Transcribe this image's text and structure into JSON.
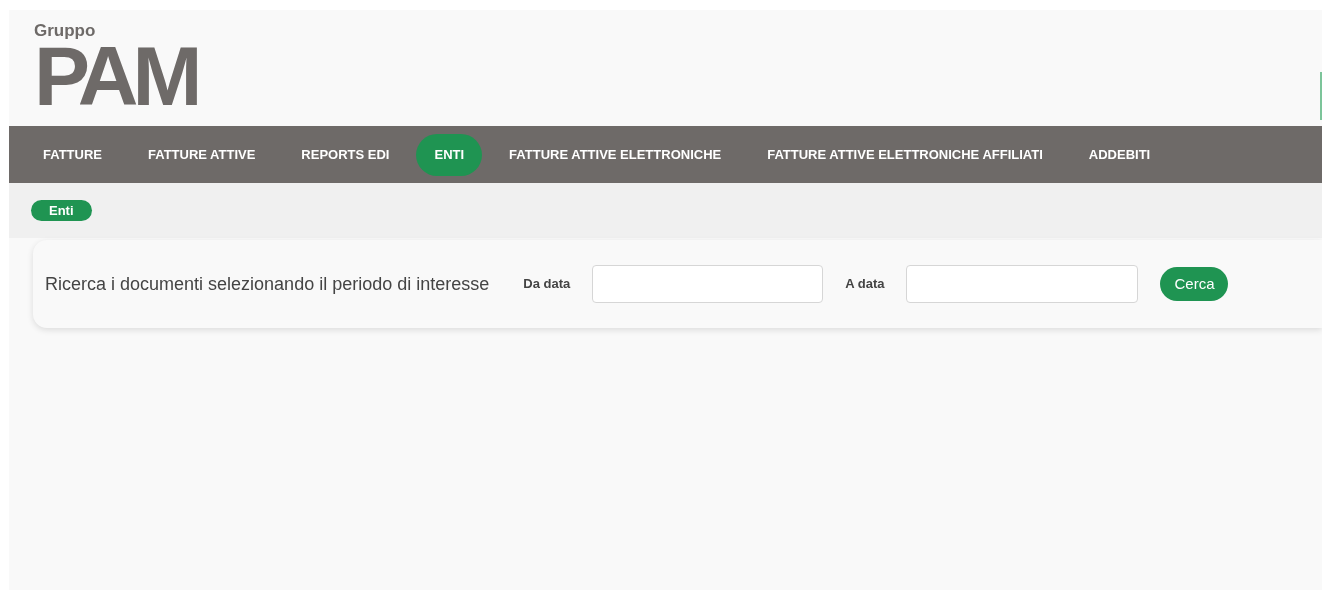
{
  "logo": {
    "group": "Gruppo",
    "brand": "PAM"
  },
  "nav": [
    {
      "label": "FATTURE",
      "selected": false
    },
    {
      "label": "FATTURE ATTIVE",
      "selected": false
    },
    {
      "label": "REPORTS EDI",
      "selected": false
    },
    {
      "label": "ENTI",
      "selected": true
    },
    {
      "label": "FATTURE ATTIVE ELETTRONICHE",
      "selected": false
    },
    {
      "label": "FATTURE ATTIVE ELETTRONICHE AFFILIATI",
      "selected": false
    },
    {
      "label": "ADDEBITI",
      "selected": false
    }
  ],
  "breadcrumb": "Enti",
  "search": {
    "title": "Ricerca i documenti selezionando il periodo di interesse",
    "from_label": "Da data",
    "to_label": "A data",
    "button": "Cerca"
  }
}
